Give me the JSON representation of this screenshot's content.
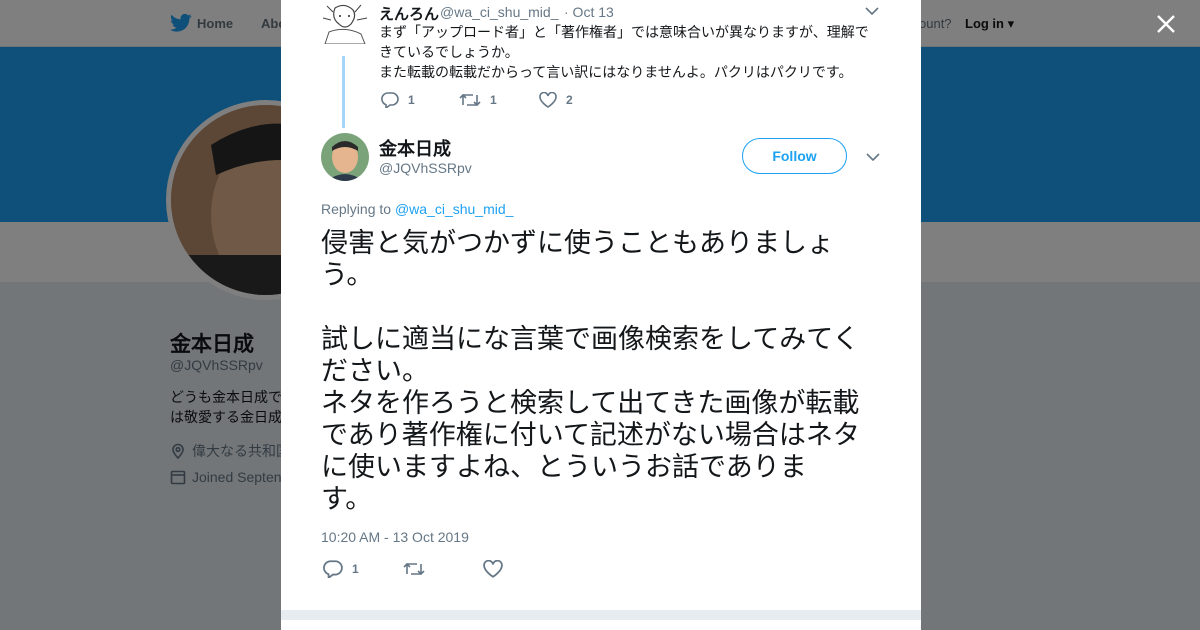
{
  "nav": {
    "home_label": "Home",
    "about_label": "Abo",
    "account_prompt": "ccount?",
    "login_label": "Log in"
  },
  "profile": {
    "name": "金本日成",
    "handle": "@JQVhSSRpv",
    "bio_line1": "どうも金本日成で",
    "bio_line2": "は敬愛する金日成",
    "location": "偉大なる共和国",
    "joined": "Joined Septen"
  },
  "parent_tweet": {
    "name": "えんろん",
    "handle": "@wa_ci_shu_mid_",
    "date": "· Oct 13",
    "text_line1": "まず「アップロード者」と「著作権者」では意味合いが異なりますが、理解で",
    "text_line2": "きているでしょうか。",
    "text_line3": "また転載の転載だからって言い訳にはなりませんよ。パクリはパクリです。",
    "reply_count": "1",
    "retweet_count": "1",
    "like_count": "2"
  },
  "main_tweet": {
    "name": "金本日成",
    "handle": "@JQVhSSRpv",
    "follow_label": "Follow",
    "replying_prefix": "Replying to ",
    "replying_handle": "@wa_ci_shu_mid_",
    "text_line1": "侵害と気がつかずに使うこともありましょ",
    "text_line2": "う。",
    "text_line3": "試しに適当にな言葉で画像検索をしてみてく",
    "text_line4": "ださい。",
    "text_line5": "ネタを作ろうと検索して出てきた画像が転載",
    "text_line6": "であり著作権に付いて記述がない場合はネタ",
    "text_line7": "に使いますよね、とういうお話でありま",
    "text_line8": "す。",
    "timestamp": "10:20 AM - 13 Oct 2019",
    "reply_count": "1"
  },
  "colors": {
    "accent": "#1da1f2",
    "overlay": "rgba(0,0,0,0.5)",
    "muted": "#657786"
  },
  "icons": [
    "twitter-bird-icon",
    "close-icon",
    "chevron-down-icon",
    "reply-icon",
    "retweet-icon",
    "like-icon",
    "location-icon",
    "calendar-icon"
  ]
}
